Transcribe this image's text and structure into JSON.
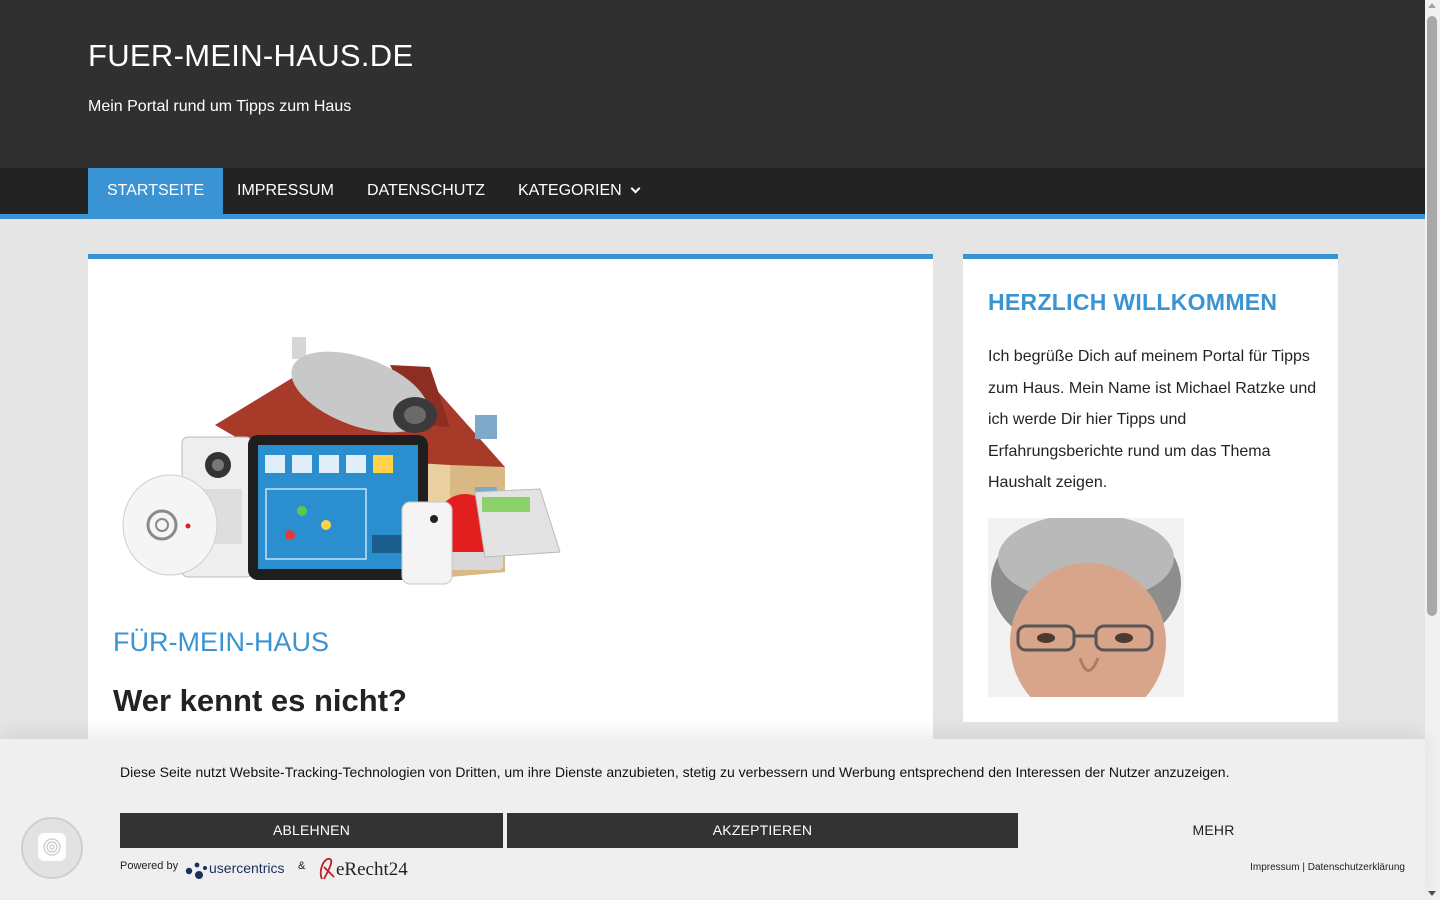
{
  "header": {
    "site_title": "FUER-MEIN-HAUS.DE",
    "tagline": "Mein Portal rund um Tipps zum Haus"
  },
  "nav": {
    "items": [
      {
        "label": "STARTSEITE",
        "active": true
      },
      {
        "label": "IMPRESSUM",
        "active": false
      },
      {
        "label": "DATENSCHUTZ",
        "active": false
      },
      {
        "label": "KATEGORIEN",
        "active": false
      }
    ]
  },
  "main": {
    "section_title": "FÜR-MEIN-HAUS",
    "heading": "Wer kennt es nicht?",
    "hero_icon": "smart-home-security-illustration"
  },
  "sidebar": {
    "widget_title": "HERZLICH WILLKOMMEN",
    "widget_text": "Ich begrüße Dich auf meinem Portal für Tipps zum Haus. Mein Name ist Michael Ratzke und ich werde Dir hier Tipps und Erfahrungsberichte rund um das Thema Haushalt zeigen.",
    "portrait_icon": "author-portrait"
  },
  "cookie": {
    "text": "Diese Seite nutzt Website-Tracking-Technologien von Dritten, um ihre Dienste anzubieten, stetig zu verbessern und Werbung entsprechend den Interessen der Nutzer anzuzeigen.",
    "decline_label": "ABLEHNEN",
    "accept_label": "AKZEPTIEREN",
    "more_label": "MEHR",
    "powered_by": "Powered by",
    "uc_logo_text": "usercentrics",
    "amp": "&",
    "erecht_logo_text": "eRecht24",
    "links": "Impressum | Datenschutzerklärung"
  },
  "colors": {
    "accent": "#3a93d2",
    "header_bg": "#303030",
    "nav_bg": "#232323",
    "page_bg": "#e5e5e5",
    "button_bg": "#333333"
  }
}
